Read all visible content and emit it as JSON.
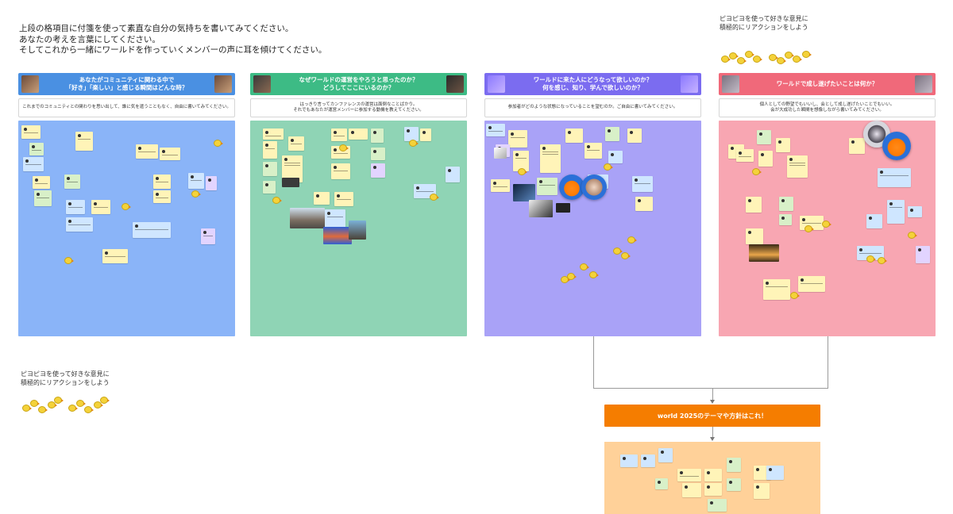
{
  "intro": {
    "lines": [
      "上段の格項目に付箋を使って素直な自分の気持ちを書いてみてください。",
      "あなたの考えを言葉にしてください。",
      "そしてこれから一緒にワールドを作っていくメンバーの声に耳を傾けてください。"
    ]
  },
  "reaction_note": {
    "lines": [
      "ピヨピヨを使って好きな意見に",
      "積極的にリアクションをしよう"
    ]
  },
  "columns": [
    {
      "header_lines": [
        "あなたがコミュニティに関わる中で",
        "「好き」「楽しい」と感じる瞬間はどんな時？"
      ],
      "sub_lines": [
        "これまでのコミュニティとの関わりを思い出して、誰に気を遣うこともなく、自由に書いてみてください。"
      ],
      "header_color": "#4a90e2",
      "board_color": "#8ab4f8"
    },
    {
      "header_lines": [
        "なぜワールドの運営をやろうと思ったのか？",
        "どうしてここにいるのか？"
      ],
      "sub_lines": [
        "はっきり言ってカンファレンスの運営は面倒なことばかり。",
        "それでもあなたが運営メンバーに参加する動機を教えてください。"
      ],
      "header_color": "#3dbb85",
      "board_color": "#8fd4b5"
    },
    {
      "header_lines": [
        "ワールドに来た人にどうなって欲しいのか？",
        "何を感じ、知り、学んで欲しいのか？"
      ],
      "sub_lines": [
        "参加者がどのような状態になっていることを望むのか。ご自由に書いてみてください。"
      ],
      "header_color": "#7b6cf0",
      "board_color": "#a9a2f7"
    },
    {
      "header_lines": [
        "ワールドで成し遂げたいことは何か？"
      ],
      "sub_lines": [
        "個人としての野望でもいいし、会として成し遂げたいことでもいい。",
        "会が大成功した瞬間を想像しながら書いてみてください。"
      ],
      "header_color": "#f0697a",
      "board_color": "#f8a6b2"
    }
  ],
  "world": {
    "title": "world 2025のテーマや方針はこれ！",
    "bar_color": "#f57d00",
    "board_color": "#ffd199"
  },
  "icons": {
    "reaction": "chick-icon",
    "avatar": "avatar-icon",
    "photo": "photo-icon"
  }
}
